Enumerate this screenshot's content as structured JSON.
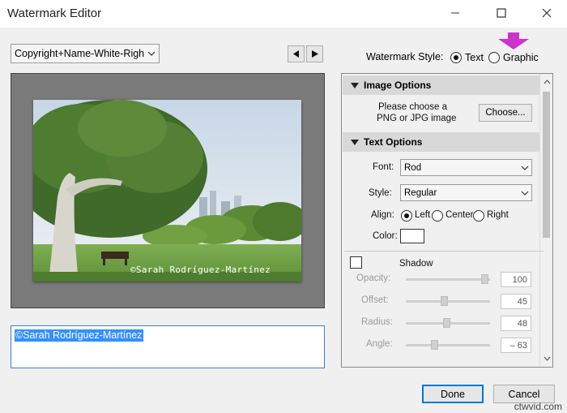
{
  "window": {
    "title": "Watermark Editor"
  },
  "preset": {
    "value": "Copyright+Name-White-Righ"
  },
  "watermark_style": {
    "label": "Watermark Style:",
    "options": [
      "Text",
      "Graphic"
    ],
    "selected": "Text"
  },
  "preview": {
    "watermark_text": "©Sarah Rodríguez-Martínez"
  },
  "text_input": {
    "value": "©Sarah Rodríguez-Martínez"
  },
  "image_options": {
    "header": "Image Options",
    "prompt_line1": "Please choose a",
    "prompt_line2": "PNG or JPG image",
    "choose_label": "Choose..."
  },
  "text_options": {
    "header": "Text Options",
    "font_label": "Font:",
    "font_value": "Rod",
    "style_label": "Style:",
    "style_value": "Regular",
    "align_label": "Align:",
    "align_options": [
      "Left",
      "Center",
      "Right"
    ],
    "align_selected": "Left",
    "color_label": "Color:",
    "color_value": "#ffffff"
  },
  "shadow": {
    "label": "Shadow",
    "enabled": false,
    "rows": [
      {
        "label": "Opacity:",
        "value": "100",
        "fraction": 0.98
      },
      {
        "label": "Offset:",
        "value": "45",
        "fraction": 0.45
      },
      {
        "label": "Radius:",
        "value": "48",
        "fraction": 0.48
      },
      {
        "label": "Angle:",
        "value": "– 63",
        "fraction": 0.33
      }
    ]
  },
  "buttons": {
    "done": "Done",
    "cancel": "Cancel"
  },
  "footer_watermark": "ctwvid.com",
  "colors": {
    "annotation_arrow": "#cc33cc",
    "selection": "#3390ff",
    "done_border": "#0078d7"
  },
  "icons": {
    "minimize": "minimize-icon",
    "maximize": "maximize-icon",
    "close": "close-icon",
    "prev": "triangle-left-icon",
    "next": "triangle-right-icon",
    "collapse": "triangle-down-icon"
  }
}
